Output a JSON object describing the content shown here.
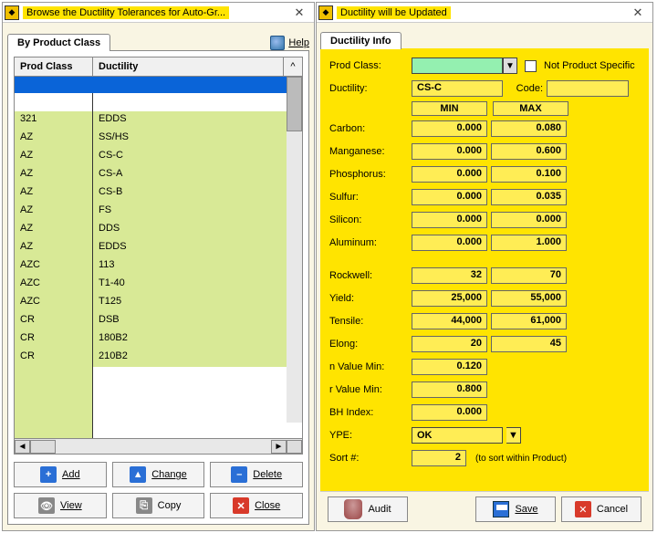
{
  "left": {
    "title": "Browse the Ductility Tolerances for Auto-Gr...",
    "tab": "By Product Class",
    "help": "Help",
    "headers": {
      "c1": "Prod Class",
      "c2": "Ductility",
      "arrow": "^"
    },
    "rows": [
      {
        "c1": "321",
        "c2": "EDDS"
      },
      {
        "c1": "AZ",
        "c2": "SS/HS"
      },
      {
        "c1": "AZ",
        "c2": "CS-C"
      },
      {
        "c1": "AZ",
        "c2": "CS-A"
      },
      {
        "c1": "AZ",
        "c2": "CS-B"
      },
      {
        "c1": "AZ",
        "c2": "FS"
      },
      {
        "c1": "AZ",
        "c2": "DDS"
      },
      {
        "c1": "AZ",
        "c2": "EDDS"
      },
      {
        "c1": "AZC",
        "c2": "113"
      },
      {
        "c1": "AZC",
        "c2": "T1-40"
      },
      {
        "c1": "AZC",
        "c2": "T125"
      },
      {
        "c1": "CR",
        "c2": "DSB"
      },
      {
        "c1": "CR",
        "c2": "180B2"
      },
      {
        "c1": "CR",
        "c2": "210B2"
      }
    ],
    "buttons": {
      "add": "Add",
      "change": "Change",
      "delete": "Delete",
      "view": "View",
      "copy": "Copy",
      "close": "Close"
    },
    "scroll_chars": {
      "left": "◄",
      "right": "►"
    }
  },
  "right": {
    "title": "Ductility will be Updated",
    "tab": "Ductility Info",
    "labels": {
      "prod_class": "Prod Class:",
      "not_specific": "Not Product Specific",
      "ductility": "Ductility:",
      "code": "Code:",
      "min": "MIN",
      "max": "MAX",
      "carbon": "Carbon:",
      "manganese": "Manganese:",
      "phosphorus": "Phosphorus:",
      "sulfur": "Sulfur:",
      "silicon": "Silicon:",
      "aluminum": "Aluminum:",
      "rockwell": "Rockwell:",
      "yield": "Yield:",
      "tensile": "Tensile:",
      "elong": "Elong:",
      "nval": "n Value Min:",
      "rval": "r Value Min:",
      "bh": "BH Index:",
      "ype": "YPE:",
      "sort": "Sort #:",
      "sort_hint": "(to sort within Product)"
    },
    "values": {
      "ductility": "CS-C",
      "code": "",
      "carbon": {
        "min": "0.000",
        "max": "0.080"
      },
      "manganese": {
        "min": "0.000",
        "max": "0.600"
      },
      "phosphorus": {
        "min": "0.000",
        "max": "0.100"
      },
      "sulfur": {
        "min": "0.000",
        "max": "0.035"
      },
      "silicon": {
        "min": "0.000",
        "max": "0.000"
      },
      "aluminum": {
        "min": "0.000",
        "max": "1.000"
      },
      "rockwell": {
        "min": "32",
        "max": "70"
      },
      "yield": {
        "min": "25,000",
        "max": "55,000"
      },
      "tensile": {
        "min": "44,000",
        "max": "61,000"
      },
      "elong": {
        "min": "20",
        "max": "45"
      },
      "nval": "0.120",
      "rval": "0.800",
      "bh": "0.000",
      "ype": "OK",
      "sort": "2"
    },
    "buttons": {
      "audit": "Audit",
      "save": "Save",
      "cancel": "Cancel"
    }
  }
}
